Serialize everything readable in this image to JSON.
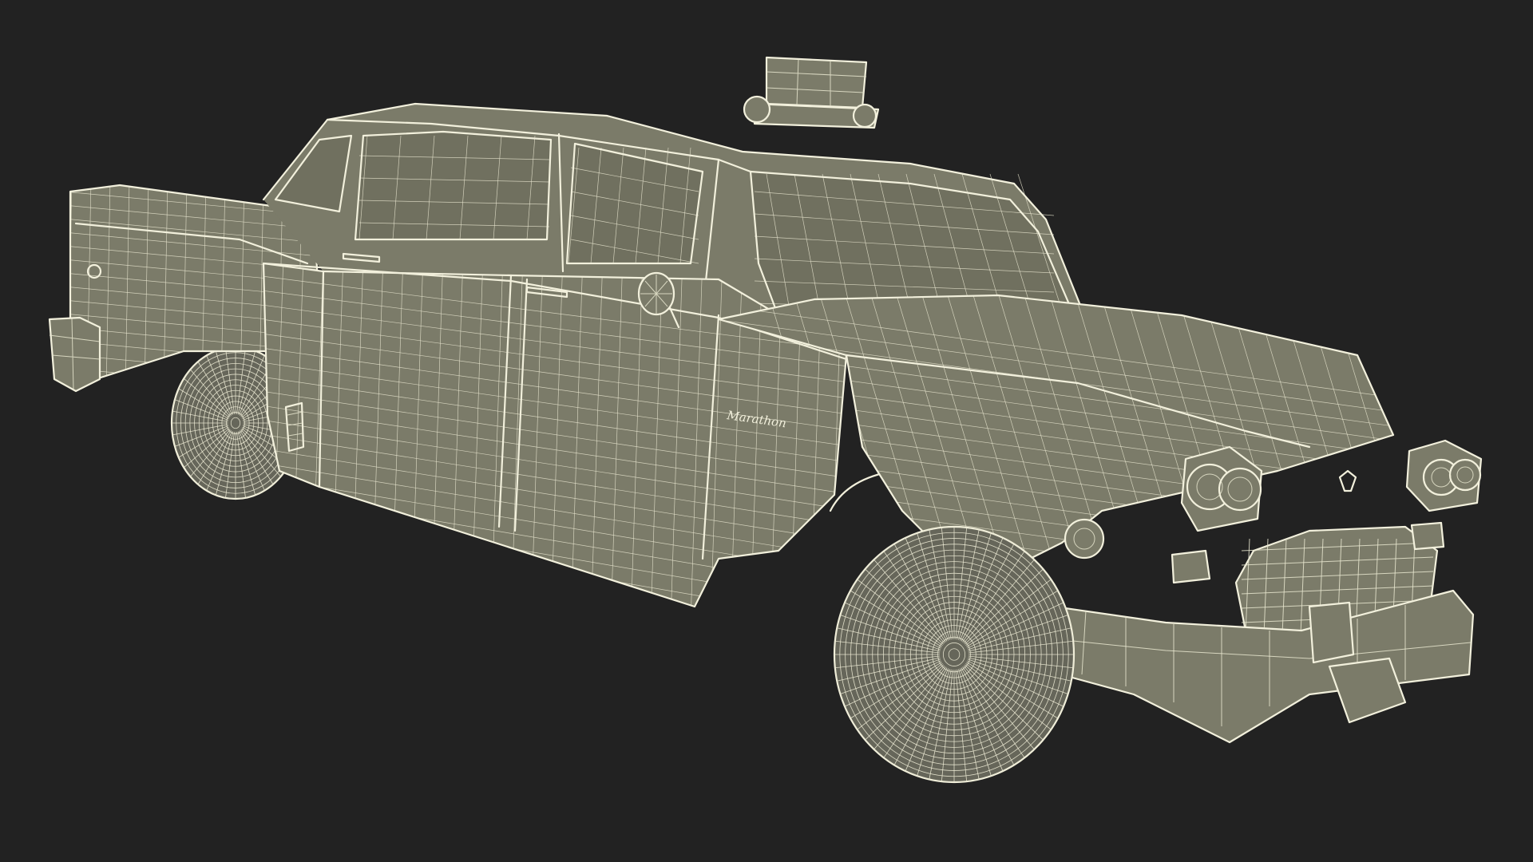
{
  "scene": {
    "background_color": "#222222",
    "model_fill_color": "#7b7b69",
    "wire_color": "#e8e6cf",
    "render_mode": "wireframe-on-shaded"
  },
  "car": {
    "badge_text": "Marathon"
  }
}
